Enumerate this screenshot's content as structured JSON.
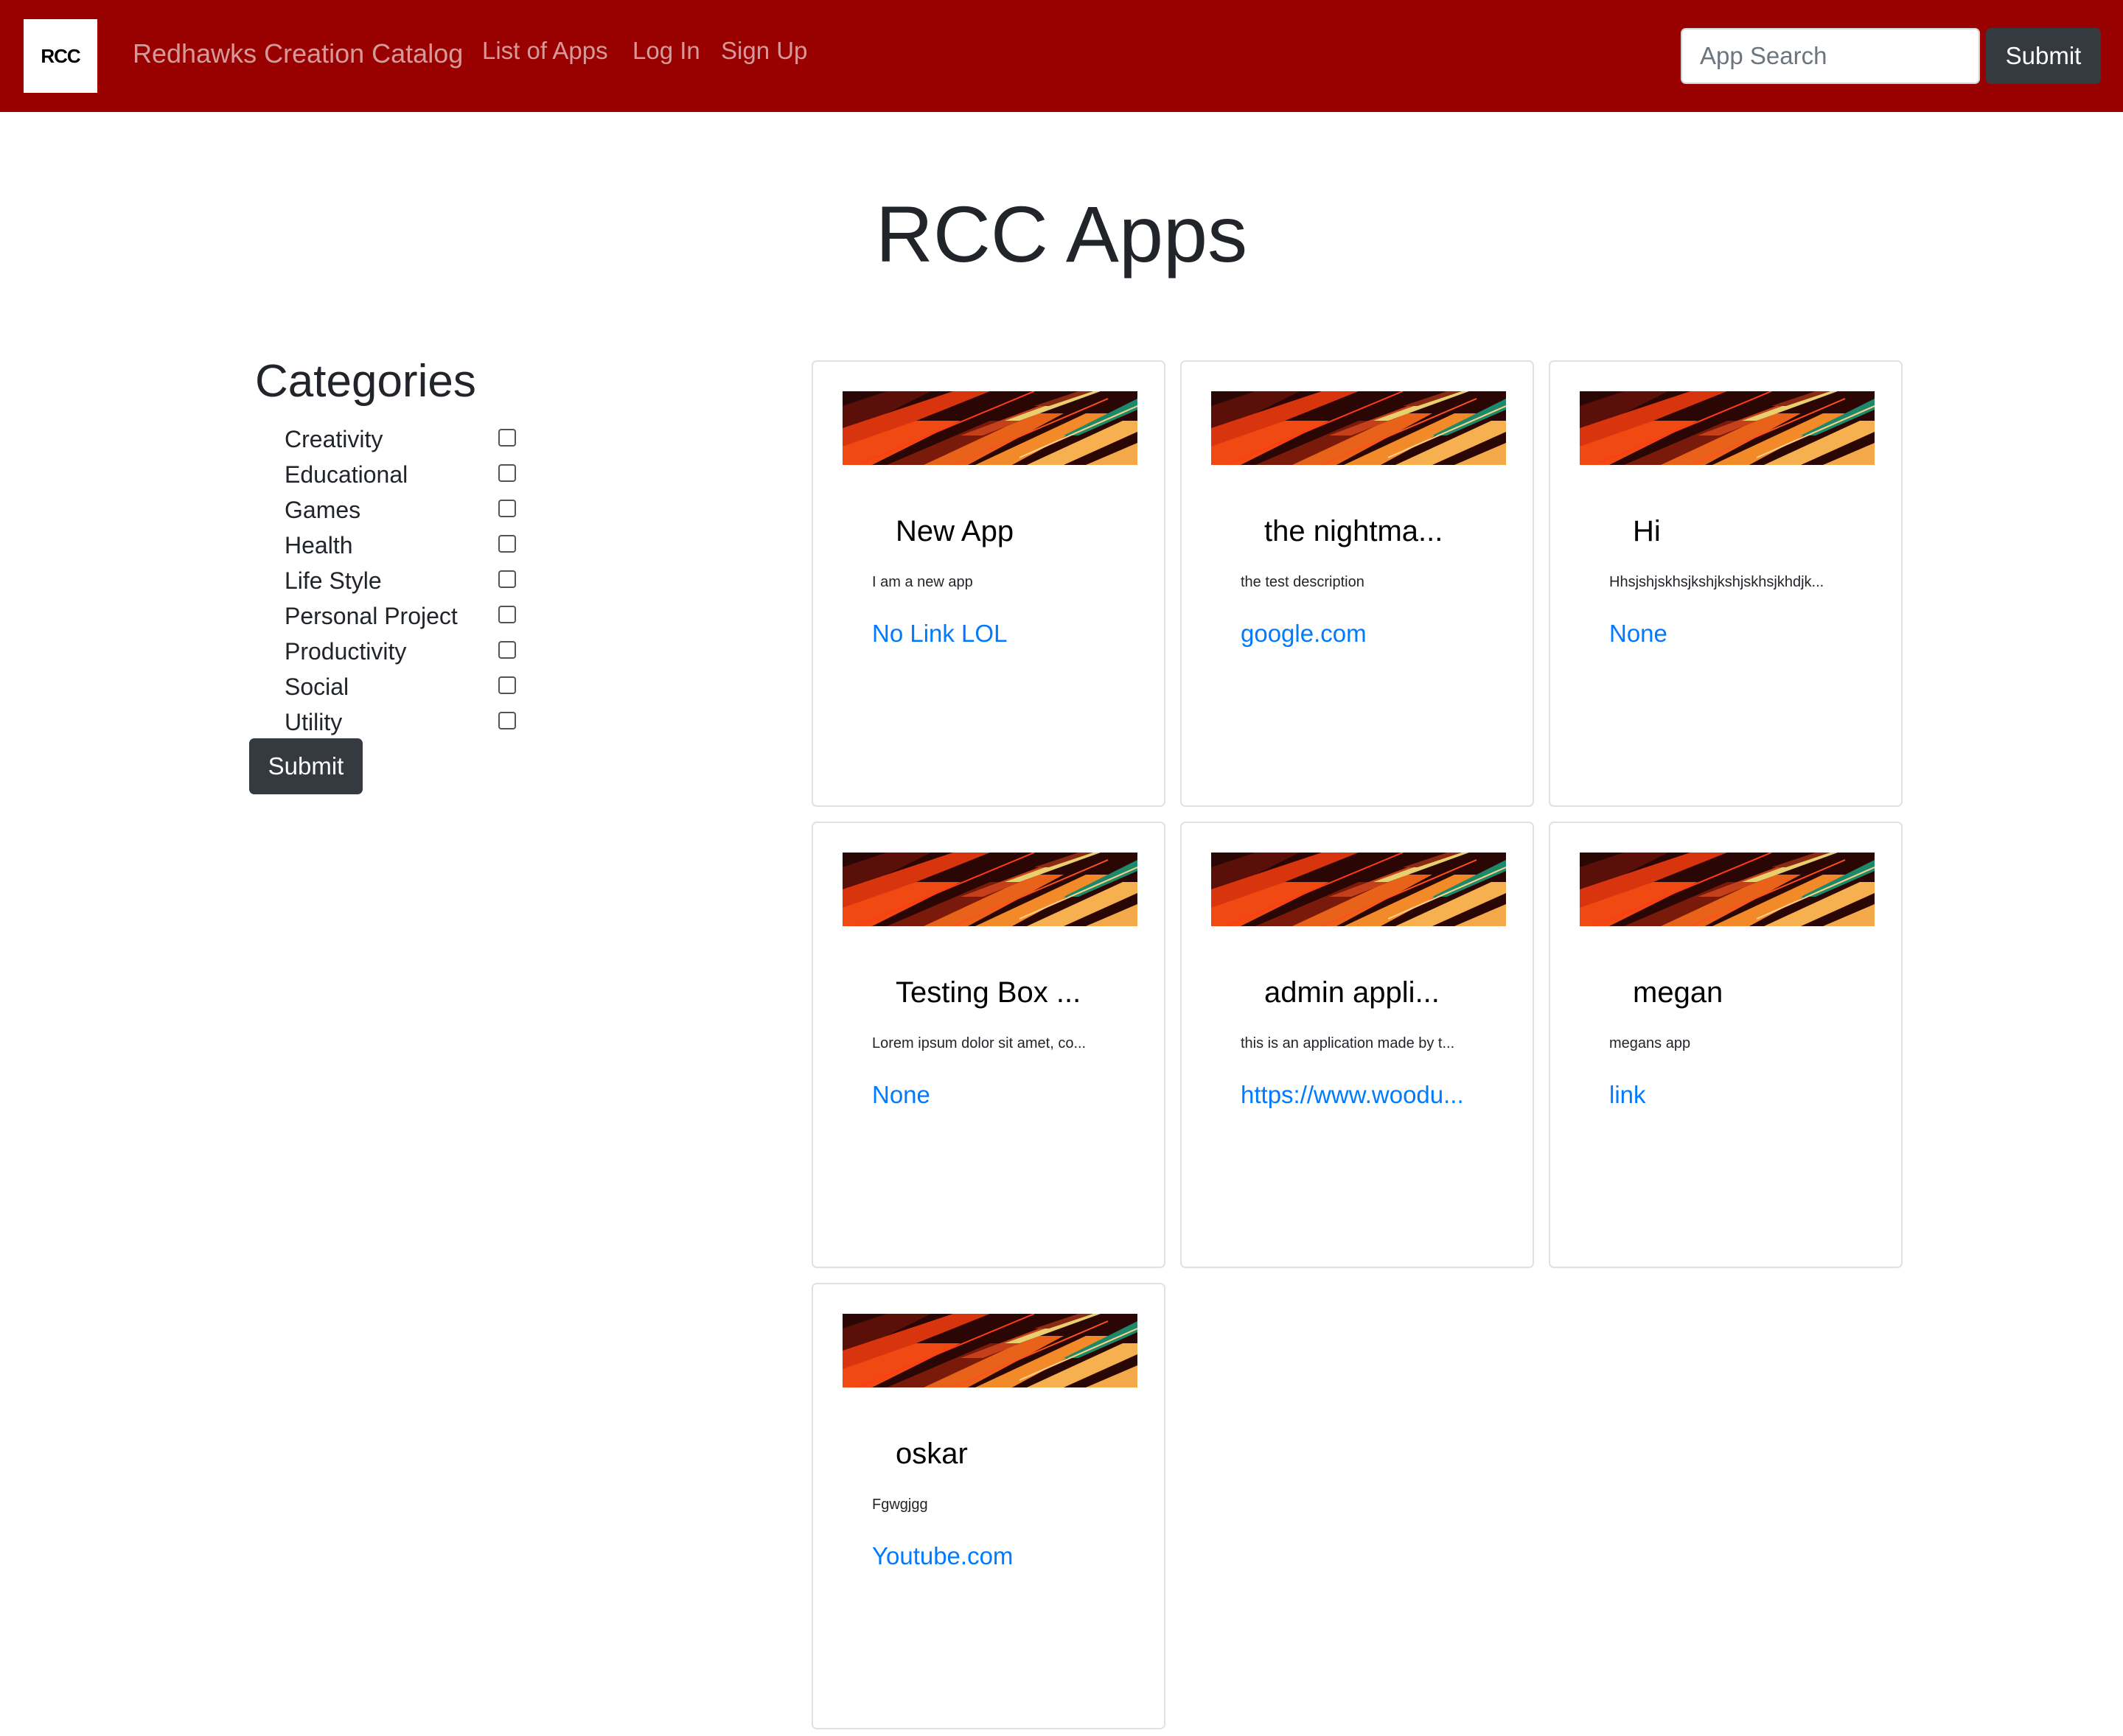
{
  "navbar": {
    "logo_text": "RCC",
    "brand": "Redhawks Creation Catalog",
    "links": [
      "List of Apps",
      "Log In",
      "Sign Up"
    ],
    "search_placeholder": "App Search",
    "submit_label": "Submit",
    "background_color": "#990000"
  },
  "page": {
    "title": "RCC Apps"
  },
  "sidebar": {
    "heading": "Categories",
    "categories": [
      {
        "label": "Creativity",
        "checked": false
      },
      {
        "label": "Educational",
        "checked": false
      },
      {
        "label": "Games",
        "checked": false
      },
      {
        "label": "Health",
        "checked": false
      },
      {
        "label": "Life Style",
        "checked": false
      },
      {
        "label": "Personal Project",
        "checked": false
      },
      {
        "label": "Productivity",
        "checked": false
      },
      {
        "label": "Social",
        "checked": false
      },
      {
        "label": "Utility",
        "checked": false
      }
    ],
    "submit_label": "Submit"
  },
  "apps": [
    {
      "title": "New App",
      "description": "I am a new app",
      "link": "No Link LOL"
    },
    {
      "title": "the nightma...",
      "description": "the test description",
      "link": "google.com"
    },
    {
      "title": "Hi",
      "description": "Hhsjshjskhsjkshjkshjskhsjkhdjk...",
      "link": "None"
    },
    {
      "title": "Testing Box ...",
      "description": "Lorem ipsum dolor sit amet, co...",
      "link": "None"
    },
    {
      "title": "admin appli...",
      "description": "this is an application made by t...",
      "link": "https://www.woodu..."
    },
    {
      "title": "megan",
      "description": "megans app",
      "link": "link"
    },
    {
      "title": "oskar",
      "description": "Fgwgjgg",
      "link": "Youtube.com"
    }
  ],
  "colors": {
    "link": "#007bff",
    "button_dark": "#343a40"
  }
}
